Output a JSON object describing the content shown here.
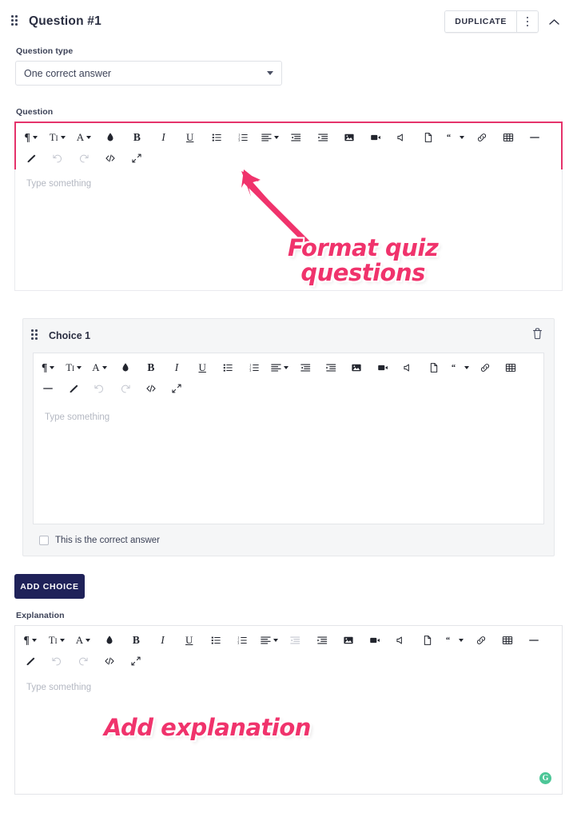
{
  "header": {
    "title": "Question #1",
    "drag_handle": "drag-handle",
    "duplicate_label": "DUPLICATE",
    "kebab": "more-options",
    "collapse": "collapse"
  },
  "question_type": {
    "label": "Question type",
    "value": "One correct answer"
  },
  "question": {
    "label": "Question",
    "placeholder": "Type something"
  },
  "choice": {
    "title": "Choice 1",
    "placeholder": "Type something",
    "correct_label": "This is the correct answer",
    "correct_checked": false,
    "delete": "delete-choice"
  },
  "add_choice_label": "ADD CHOICE",
  "explanation": {
    "label": "Explanation",
    "placeholder": "Type something"
  },
  "grammarly_badge": "G",
  "annotations": {
    "format": "Format quiz questions",
    "format_line1": "Format quiz",
    "format_line2": "questions",
    "explanation": "Add explanation"
  },
  "colors": {
    "accent_pink": "#e5336b",
    "annotation_pink": "#f0336c",
    "navy": "#1f2259",
    "grammarly_green": "#3ec28f",
    "panel_gray": "#f5f6f7",
    "border": "#e3e5e9"
  },
  "toolbar_icons": [
    {
      "name": "paragraph-style-icon",
      "glyph": "¶",
      "caret": true,
      "dim": false
    },
    {
      "name": "text-size-icon",
      "glyph": "TI",
      "caret": true,
      "dim": false
    },
    {
      "name": "font-color-icon",
      "glyph": "A",
      "caret": true,
      "dim": false
    },
    {
      "name": "highlight-color-icon",
      "glyph": "droplet",
      "caret": false,
      "dim": false
    },
    {
      "name": "bold-icon",
      "glyph": "B",
      "caret": false,
      "dim": false
    },
    {
      "name": "italic-icon",
      "glyph": "I",
      "caret": false,
      "dim": false
    },
    {
      "name": "underline-icon",
      "glyph": "U",
      "caret": false,
      "dim": false
    },
    {
      "name": "bulleted-list-icon",
      "glyph": "ul",
      "caret": false,
      "dim": false
    },
    {
      "name": "numbered-list-icon",
      "glyph": "ol",
      "caret": false,
      "dim": false
    },
    {
      "name": "align-icon",
      "glyph": "align",
      "caret": true,
      "dim": false
    },
    {
      "name": "outdent-icon",
      "glyph": "outdent",
      "caret": false,
      "dim": false
    },
    {
      "name": "indent-icon",
      "glyph": "indent",
      "caret": false,
      "dim": false
    },
    {
      "name": "insert-image-icon",
      "glyph": "image",
      "caret": false,
      "dim": false
    },
    {
      "name": "insert-video-icon",
      "glyph": "video",
      "caret": false,
      "dim": false
    },
    {
      "name": "insert-audio-icon",
      "glyph": "audio",
      "caret": false,
      "dim": false
    },
    {
      "name": "insert-file-icon",
      "glyph": "file",
      "caret": false,
      "dim": false
    },
    {
      "name": "blockquote-icon",
      "glyph": "quote",
      "caret": true,
      "dim": false
    },
    {
      "name": "insert-link-icon",
      "glyph": "link",
      "caret": false,
      "dim": false
    },
    {
      "name": "insert-table-icon",
      "glyph": "table",
      "caret": false,
      "dim": false
    },
    {
      "name": "horizontal-rule-icon",
      "glyph": "hr",
      "caret": false,
      "dim": false
    },
    {
      "name": "clear-formatting-icon",
      "glyph": "eraser",
      "caret": false,
      "dim": false
    },
    {
      "name": "undo-icon",
      "glyph": "undo",
      "caret": false,
      "dim": true
    },
    {
      "name": "redo-icon",
      "glyph": "redo",
      "caret": false,
      "dim": true
    },
    {
      "name": "code-view-icon",
      "glyph": "code",
      "caret": false,
      "dim": false
    },
    {
      "name": "fullscreen-icon",
      "glyph": "expand",
      "caret": false,
      "dim": false
    }
  ],
  "explanation_toolbar_dim_index": 10
}
